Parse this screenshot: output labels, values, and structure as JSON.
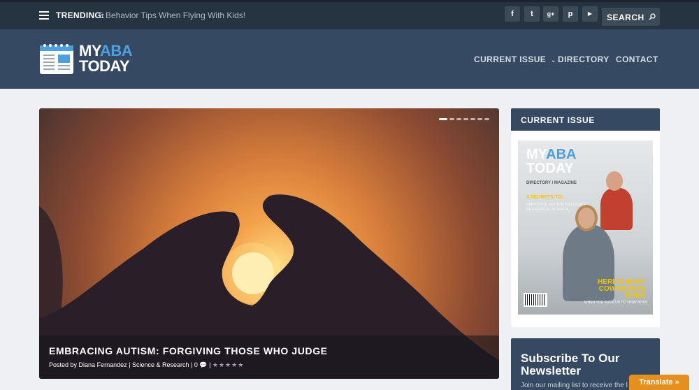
{
  "topbar": {
    "trending_label": "TRENDING:",
    "trending_text": "5 Behavior Tips When Flying With Kids!",
    "social": [
      {
        "icon": "facebook-icon",
        "glyph": "f"
      },
      {
        "icon": "twitter-icon",
        "glyph": "t"
      },
      {
        "icon": "google-plus-icon",
        "glyph": "g+"
      },
      {
        "icon": "pinterest-icon",
        "glyph": "p"
      },
      {
        "icon": "youtube-icon",
        "glyph": "▶"
      }
    ],
    "search_label": "SEARCH"
  },
  "header": {
    "logo_my": "MY",
    "logo_aba": "ABA",
    "logo_today": "TODAY",
    "nav": {
      "current_issue": "CURRENT ISSUE",
      "directory": "DIRECTORY",
      "contact": "CONTACT"
    }
  },
  "hero": {
    "title": "EMBRACING AUTISM: FORGIVING THOSE WHO JUDGE",
    "meta_prefix": "Posted by",
    "author": "Diana Fernandez",
    "category": "Science & Research",
    "comments": "0",
    "rating_stars": "★★★★★",
    "slide_count": 7,
    "active_slide": 1
  },
  "sidebar": {
    "current_issue_title": "CURRENT ISSUE",
    "cover": {
      "logo_my": "MY",
      "logo_aba": "ABA",
      "logo_today": "TODAY",
      "subtitle": "DIRECTORY / MAGAZINE",
      "secret": "4 SECRETS TO:",
      "secret_detail": "EMPLOYEE MOTIVATION USING BEHAVIORAL SCIENCE",
      "headline_1": "HERE'S WHAT",
      "headline_2": "COWORKERS",
      "headline_3": "THINK",
      "tagline": "WHEN YOU SUCK UP TO YOUR BOSS"
    },
    "newsletter_title_1": "Subscribe To Our",
    "newsletter_title_2": "Newsletter",
    "newsletter_text": "Join our mailing list to receive the l"
  },
  "translate_label": "Translate »",
  "colors": {
    "topbar": "#263442",
    "header": "#354a62",
    "accent_blue": "#4da0e0",
    "translate": "#e58f1f"
  }
}
